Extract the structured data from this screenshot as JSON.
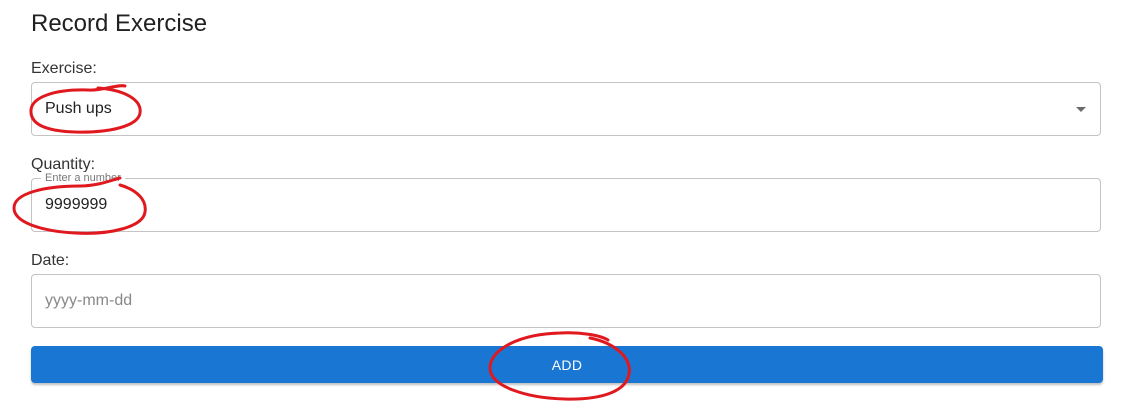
{
  "form": {
    "title": "Record Exercise",
    "exercise": {
      "label": "Exercise:",
      "value": "Push ups"
    },
    "quantity": {
      "label": "Quantity:",
      "legend": "Enter a number",
      "value": "9999999"
    },
    "date": {
      "label": "Date:",
      "placeholder": "yyyy-mm-dd"
    },
    "add_label": "ADD"
  },
  "colors": {
    "accent": "#1976d2",
    "annotation": "#e0191f",
    "border": "#c4c4c4"
  }
}
